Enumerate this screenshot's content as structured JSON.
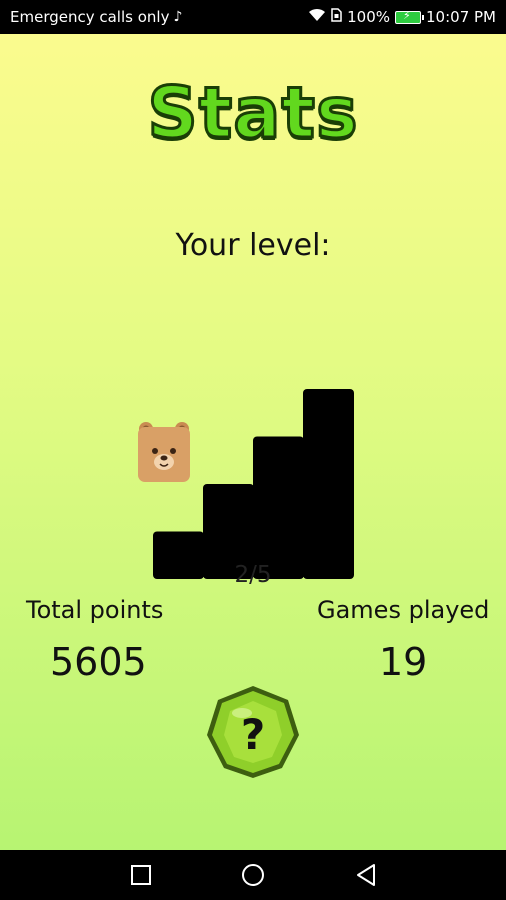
{
  "status_bar": {
    "carrier": "Emergency calls only",
    "battery_percent": "100%",
    "time": "10:07 PM",
    "icons": [
      "tiktok-icon",
      "wifi-icon",
      "sim-icon",
      "battery-charging-icon"
    ]
  },
  "screen": {
    "title": "Stats",
    "level_label": "Your level:",
    "level": {
      "current": 2,
      "total": 5
    },
    "level_text": "2/5",
    "total_points_label": "Total points",
    "total_points": "5605",
    "games_played_label": "Games played",
    "games_played": "19",
    "help_symbol": "?"
  },
  "nav_bar": {
    "buttons": [
      "recents-square-icon",
      "home-circle-icon",
      "back-triangle-icon"
    ]
  },
  "colors": {
    "background_top": "#fbfb8e",
    "background_bottom": "#b7f472",
    "title_fill": "#62d81e",
    "title_outline": "#1a3e06",
    "stairs": "#000000",
    "bear": "#d9a066",
    "help_gem": "#8fcf2a"
  }
}
